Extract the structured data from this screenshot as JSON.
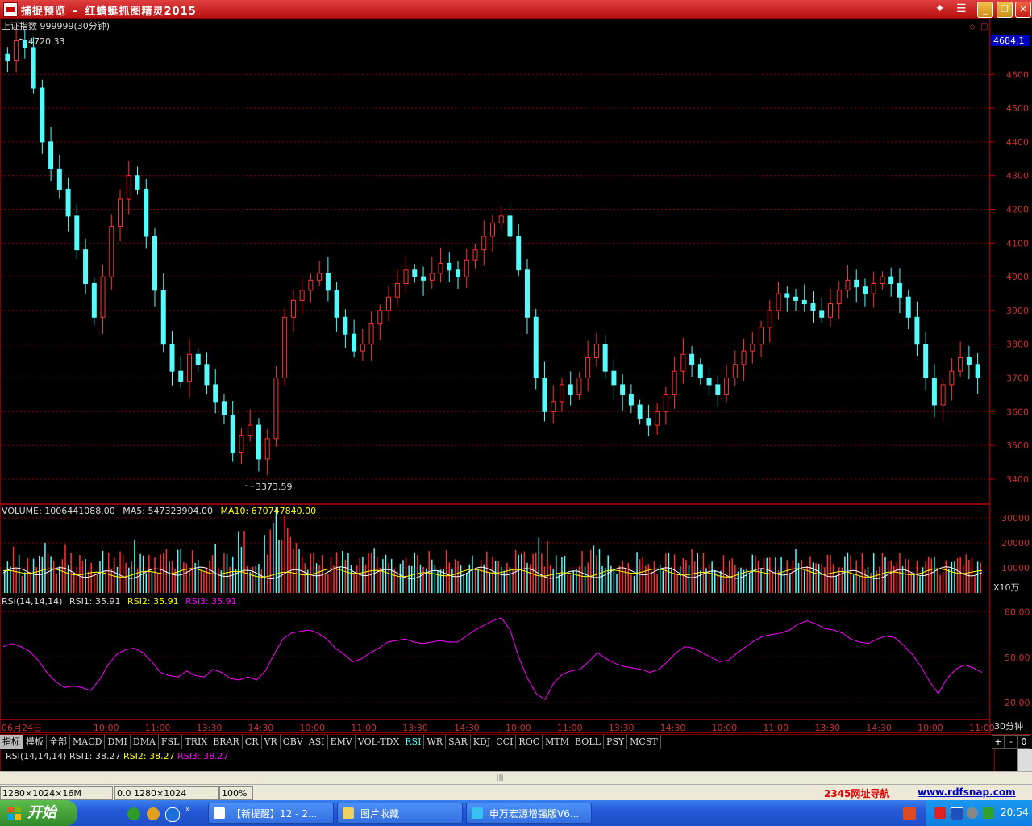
{
  "window": {
    "title": "捕捉预览",
    "dash": "–",
    "app_name": "红蜻蜓抓图精灵2015"
  },
  "chart": {
    "symbol_label": "上证指数 999999(30分钟)",
    "current_price_tag": "4684.1",
    "high_label": "4720.33",
    "low_label": "3373.59",
    "price_ticks": [
      "4600",
      "4500",
      "4400",
      "4300",
      "4200",
      "4100",
      "4000",
      "3900",
      "3800",
      "3700",
      "3600",
      "3500",
      "3400"
    ],
    "volume_label": "VOLUME: 1006441088.00",
    "ma5_label": "MA5: 547323904.00",
    "ma10_label": "MA10: 670747840.00",
    "volume_ticks": [
      "30000",
      "20000",
      "10000"
    ],
    "volume_unit": "X10万",
    "rsi_label": "RSI(14,14,14)",
    "rsi1_label": "RSI1: 35.91",
    "rsi2_label": "RSI2: 35.91",
    "rsi3_label": "RSI3: 35.91",
    "rsi_ticks": [
      "80.00",
      "50.00",
      "20.00"
    ],
    "time_labels": [
      "06月24日",
      "10:00",
      "11:00",
      "13:30",
      "14:30",
      "10:00",
      "11:00",
      "13:30",
      "14:30",
      "10:00",
      "11:00",
      "13:30",
      "14:30",
      "10:00",
      "11:00",
      "13:30",
      "14:30",
      "10:00",
      "11:00"
    ],
    "period_label": "30分钟",
    "colors": {
      "up": "#ff3232",
      "down": "#54fcfc",
      "ma5": "#ffffff",
      "ma10": "#ffff00",
      "rsi": "#ff00ff",
      "grid": "#8b0000"
    }
  },
  "chart_data": {
    "type": "candlestick",
    "title": "上证指数 999999(30分钟)",
    "y_range": [
      3373.59,
      4720.33
    ],
    "price_highlights": {
      "high": 4720.33,
      "low": 3373.59,
      "last": 4684.1
    },
    "close_series": [
      4640,
      4700,
      4680,
      4560,
      4400,
      4320,
      4260,
      4180,
      4080,
      3980,
      3880,
      4000,
      4150,
      4230,
      4300,
      4260,
      4120,
      3960,
      3800,
      3720,
      3690,
      3770,
      3740,
      3680,
      3630,
      3590,
      3480,
      3530,
      3560,
      3460,
      3520,
      3700,
      3880,
      3930,
      3960,
      3990,
      4010,
      3960,
      3880,
      3830,
      3780,
      3800,
      3860,
      3900,
      3940,
      3980,
      4020,
      4000,
      3990,
      4010,
      4040,
      4020,
      4000,
      4050,
      4080,
      4120,
      4160,
      4180,
      4120,
      4020,
      3880,
      3700,
      3600,
      3630,
      3680,
      3650,
      3700,
      3760,
      3800,
      3720,
      3680,
      3650,
      3620,
      3580,
      3560,
      3600,
      3650,
      3720,
      3770,
      3740,
      3700,
      3680,
      3650,
      3700,
      3740,
      3780,
      3800,
      3850,
      3900,
      3950,
      3940,
      3930,
      3920,
      3900,
      3880,
      3920,
      3960,
      3990,
      3970,
      3950,
      3980,
      4000,
      3980,
      3940,
      3880,
      3800,
      3700,
      3620,
      3680,
      3720,
      3760,
      3740,
      3700
    ],
    "volume_series": [
      12,
      14,
      11,
      13,
      15,
      12,
      10,
      14,
      13,
      12,
      11,
      13,
      15,
      14,
      12,
      16,
      11,
      12,
      13,
      12,
      14,
      13,
      12,
      11,
      15,
      13,
      12,
      18,
      13,
      12,
      22,
      28,
      24,
      16,
      14,
      13,
      12,
      11,
      12,
      13,
      11,
      12,
      13,
      12,
      11,
      13,
      12,
      12,
      11,
      12,
      13,
      14,
      12,
      11,
      13,
      12,
      13,
      12,
      11,
      13,
      12,
      20,
      16,
      13,
      12,
      11,
      12,
      13,
      14,
      12,
      11,
      10,
      11,
      12,
      10,
      11,
      12,
      11,
      12,
      13,
      12,
      11,
      10,
      11,
      12,
      11,
      12,
      13,
      14,
      12,
      11,
      13,
      12,
      11,
      13,
      12,
      11,
      12,
      11,
      12,
      13,
      14,
      12,
      13,
      12,
      11,
      13,
      12,
      11,
      12,
      13,
      12,
      11
    ],
    "rsi_series": [
      57,
      59,
      57,
      54,
      48,
      40,
      34,
      30,
      31,
      30,
      28,
      35,
      45,
      52,
      55,
      56,
      53,
      47,
      40,
      38,
      37,
      41,
      38,
      37,
      42,
      40,
      36,
      35,
      37,
      35,
      41,
      52,
      62,
      66,
      67,
      68,
      66,
      62,
      56,
      52,
      47,
      49,
      53,
      56,
      60,
      61,
      62,
      60,
      59,
      60,
      61,
      60,
      60,
      64,
      68,
      71,
      74,
      76,
      68,
      50,
      36,
      26,
      22,
      33,
      39,
      41,
      42,
      47,
      53,
      49,
      46,
      44,
      43,
      42,
      40,
      42,
      47,
      53,
      57,
      56,
      53,
      50,
      47,
      48,
      53,
      57,
      61,
      64,
      65,
      66,
      68,
      72,
      74,
      72,
      69,
      68,
      66,
      62,
      60,
      59,
      62,
      64,
      63,
      58,
      52,
      44,
      34,
      26,
      36,
      42,
      45,
      43,
      40
    ],
    "volume_range": [
      0,
      30000
    ],
    "rsi_range": [
      10,
      85
    ]
  },
  "tabs": [
    "指标",
    "模板",
    "全部",
    "MACD",
    "DMI",
    "DMA",
    "FSL",
    "TRIX",
    "BRAR",
    "CR",
    "VR",
    "OBV",
    "ASI",
    "EMV",
    "VOL-TDX",
    "RSI",
    "WR",
    "SAR",
    "KDJ",
    "CCI",
    "ROC",
    "MTM",
    "BOLL",
    "PSY",
    "MCST"
  ],
  "tab_controls": [
    "+",
    "-",
    "0"
  ],
  "sub_panel": {
    "rsi_label": "RSI(14,14,14)",
    "rsi1": "RSI1: 38.27",
    "rsi2": "RSI2: 38.27",
    "rsi3": "RSI3: 38.27"
  },
  "statusbar": {
    "field1": "1280×1024×16M",
    "field2": "0.0 1280×1024",
    "field3": "100%",
    "link1": "2345网址导航",
    "link2": "www.rdfsnap.com"
  },
  "taskbar": {
    "start": "开始",
    "tasks": [
      "【新提醒】12 - 2...",
      "图片收藏",
      "申万宏源增强版V6..."
    ],
    "clock": "20:54"
  }
}
